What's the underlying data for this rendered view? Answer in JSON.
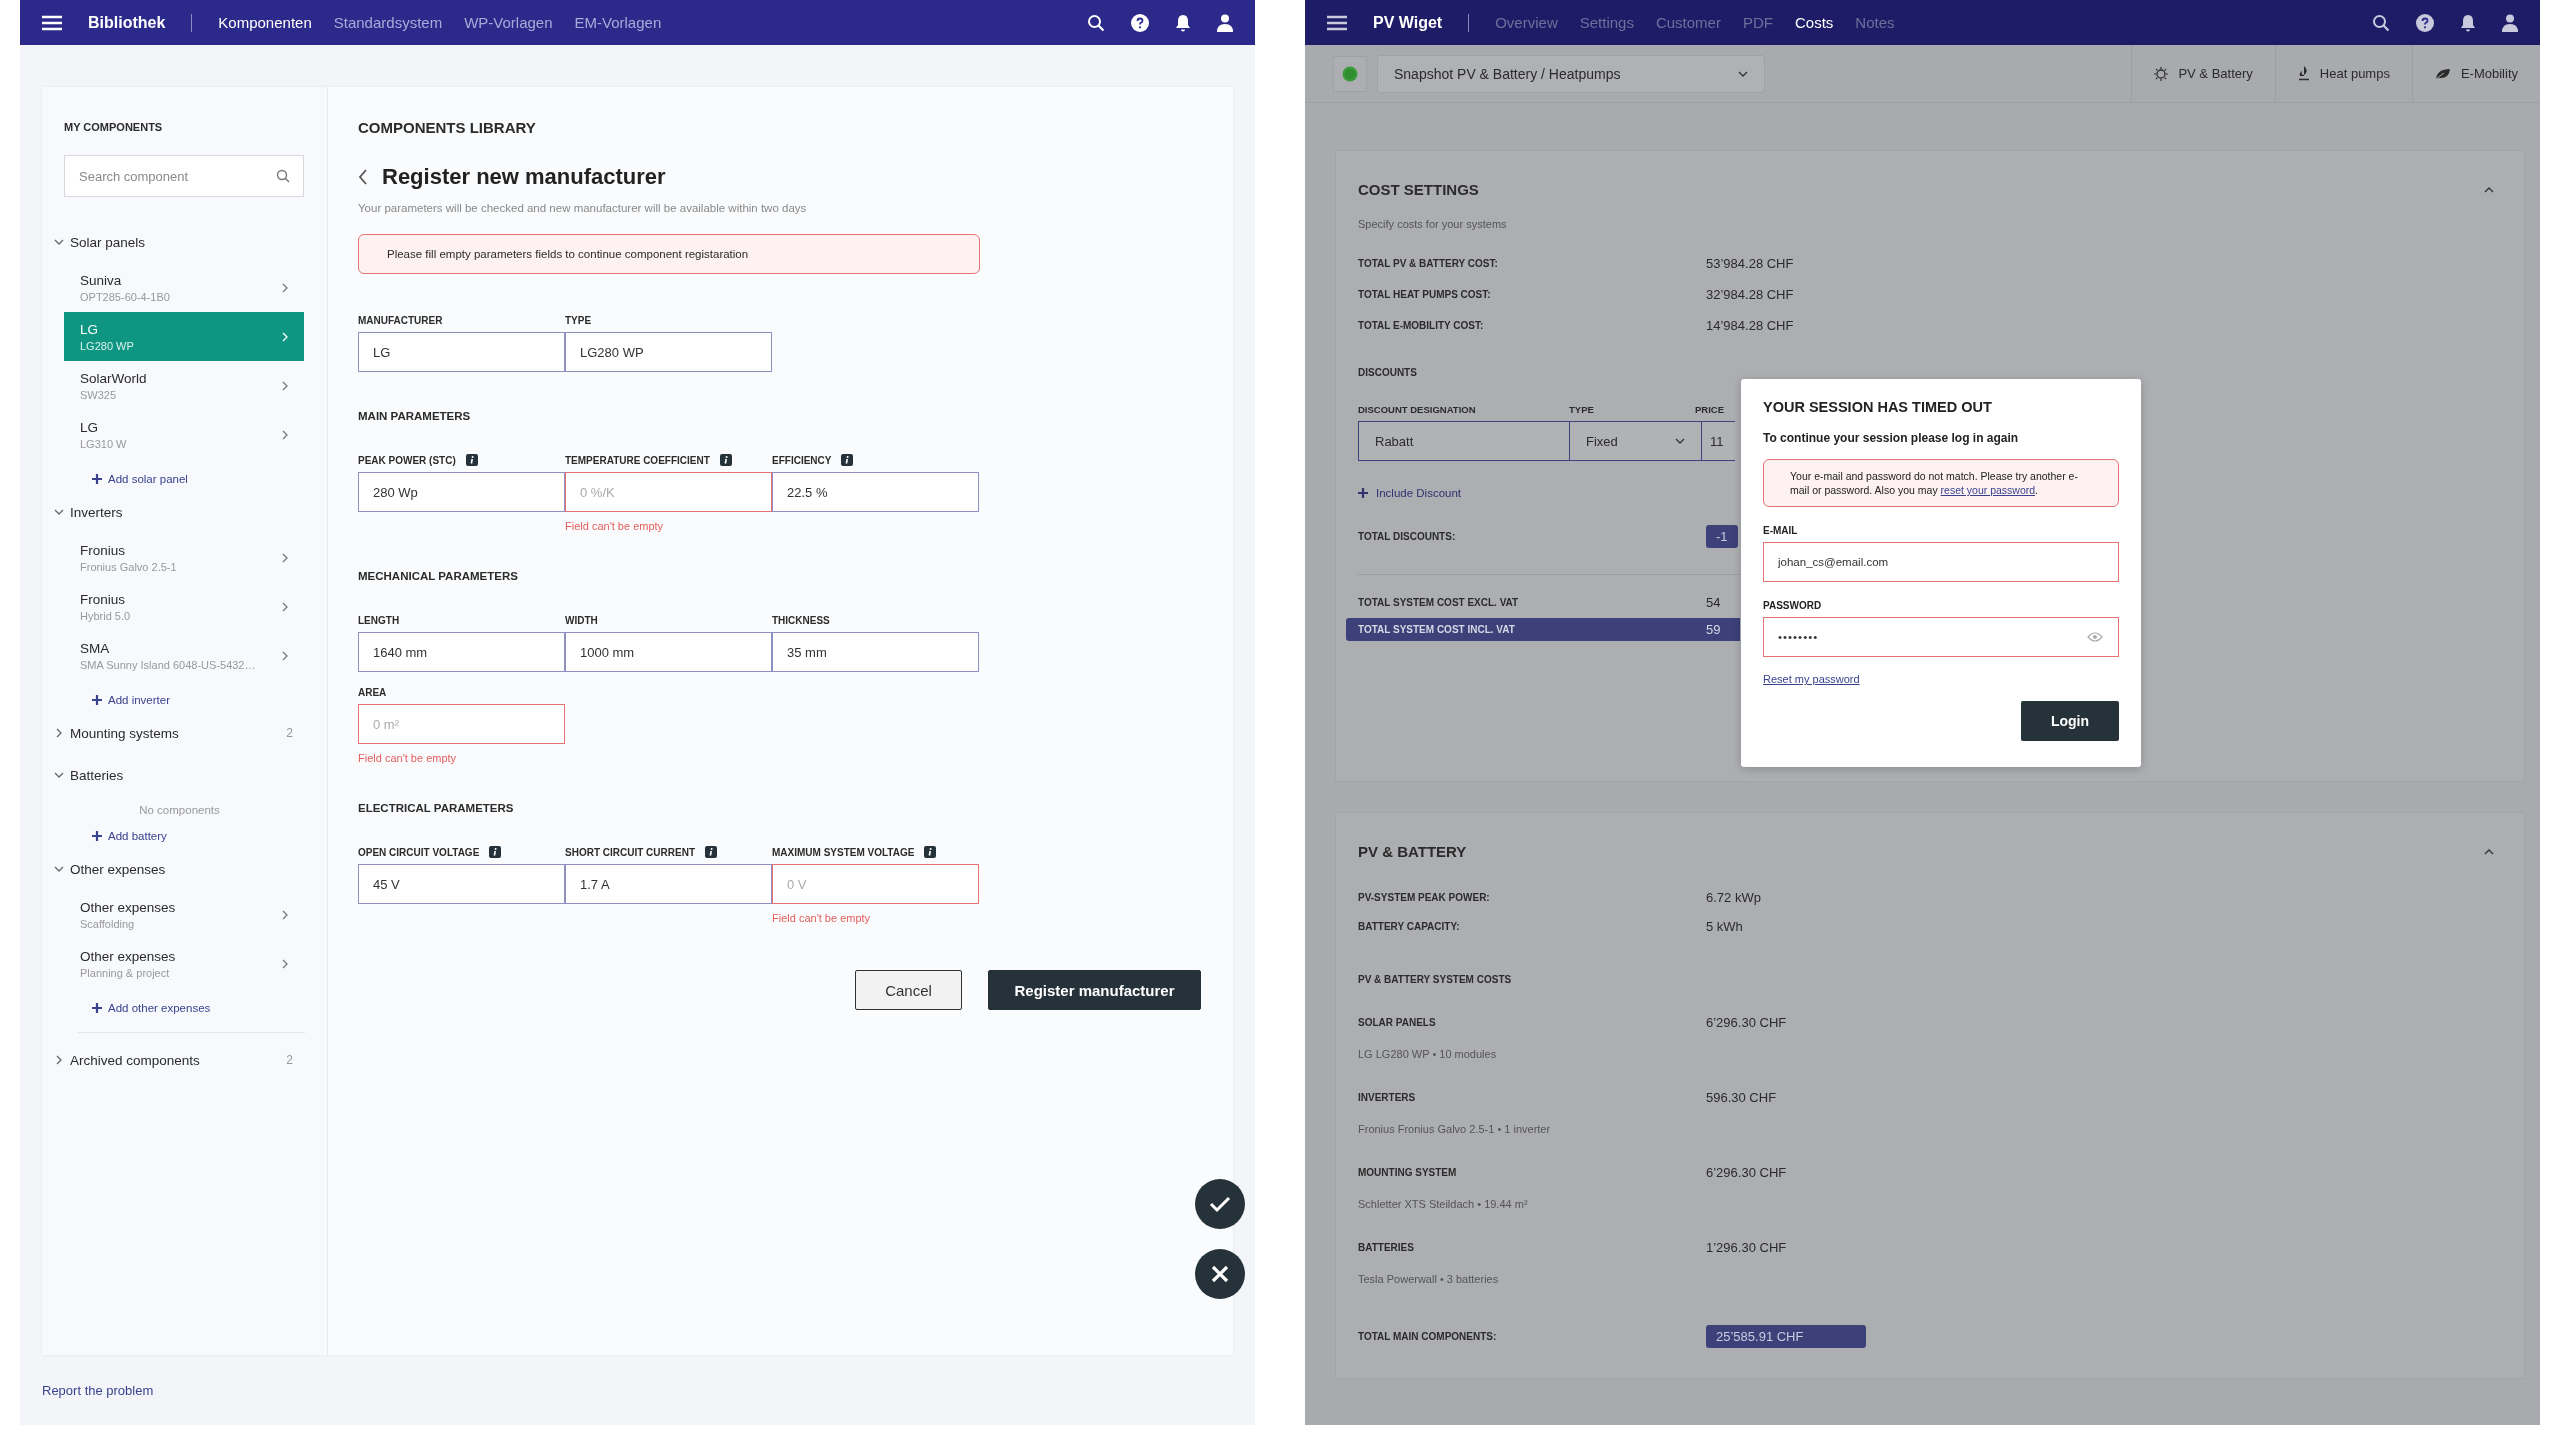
{
  "library_app": {
    "top_bar": {
      "title": "Bibliothek",
      "tabs": [
        {
          "label": "Komponenten",
          "selected": true
        },
        {
          "label": "Standardsystem",
          "selected": false
        },
        {
          "label": "WP-Vorlagen",
          "selected": false
        },
        {
          "label": "EM-Vorlagen",
          "selected": false
        }
      ]
    },
    "sidebar": {
      "heading": "MY COMPONENTS",
      "search": {
        "placeholder": "Search component"
      },
      "groups": [
        {
          "label": "Solar panels",
          "expanded": true,
          "items": [
            {
              "name": "Suniva",
              "model": "OPT285-60-4-1B0",
              "selected": false
            },
            {
              "name": "LG",
              "model": "LG280 WP",
              "selected": true
            },
            {
              "name": "SolarWorld",
              "model": "SW325",
              "selected": false
            },
            {
              "name": "LG",
              "model": "LG310 W",
              "selected": false
            }
          ],
          "add_label": "Add solar panel"
        },
        {
          "label": "Inverters",
          "expanded": true,
          "items": [
            {
              "name": "Fronius",
              "model": "Fronius Galvo 2.5-1",
              "selected": false
            },
            {
              "name": "Fronius",
              "model": "Hybrid 5.0",
              "selected": false
            },
            {
              "name": "SMA",
              "model": "SMA Sunny Island 6048-US-5432…",
              "selected": false
            }
          ],
          "add_label": "Add inverter"
        },
        {
          "label": "Mounting systems",
          "expanded": false,
          "count": "2"
        },
        {
          "label": "Batteries",
          "expanded": true,
          "empty_text": "No components",
          "add_label": "Add battery"
        },
        {
          "label": "Other expenses",
          "expanded": true,
          "items": [
            {
              "name": "Other expenses",
              "model": "Scaffolding",
              "selected": false
            },
            {
              "name": "Other expenses",
              "model": "Planning & project",
              "selected": false
            }
          ],
          "add_label": "Add other expenses"
        }
      ],
      "archived": {
        "label": "Archived components",
        "expanded": false,
        "count": "2"
      }
    },
    "main": {
      "heading": "COMPONENTS LIBRARY",
      "title": "Register new manufacturer",
      "subtitle": "Your parameters will be checked and new manufacturer will be available within two days",
      "alert": "Please fill empty parameters fields to continue component registaration",
      "sections": [
        {
          "rows": [
            [
              {
                "label": "MANUFACTURER",
                "value": "LG",
                "info": false,
                "invalid": false
              },
              {
                "label": "TYPE",
                "value": "LG280 WP",
                "info": false,
                "invalid": false
              }
            ]
          ]
        },
        {
          "title": "MAIN PARAMETERS",
          "rows": [
            [
              {
                "label": "PEAK POWER (STC)",
                "value": "280 Wp",
                "info": true,
                "invalid": false
              },
              {
                "label": "TEMPERATURE COEFFICIENT",
                "placeholder": "0 %/K",
                "info": true,
                "invalid": true,
                "error": "Field can't be empty"
              },
              {
                "label": "EFFICIENCY",
                "value": "22.5 %",
                "info": true,
                "invalid": false
              }
            ]
          ]
        },
        {
          "title": "MECHANICAL PARAMETERS",
          "rows": [
            [
              {
                "label": "LENGTH",
                "value": "1640 mm",
                "info": false,
                "invalid": false
              },
              {
                "label": "WIDTH",
                "value": "1000 mm",
                "info": false,
                "invalid": false
              },
              {
                "label": "THICKNESS",
                "value": "35 mm",
                "info": false,
                "invalid": false
              }
            ],
            [
              {
                "label": "AREA",
                "placeholder": "0 m²",
                "info": false,
                "invalid": true,
                "error": "Field can't be empty"
              }
            ]
          ]
        },
        {
          "title": "ELECTRICAL PARAMETERS",
          "rows": [
            [
              {
                "label": "OPEN CIRCUIT VOLTAGE",
                "value": "45 V",
                "info": true,
                "invalid": false
              },
              {
                "label": "SHORT CIRCUIT CURRENT",
                "value": "1.7 A",
                "info": true,
                "invalid": false
              },
              {
                "label": "MAXIMUM SYSTEM VOLTAGE",
                "placeholder": "0 V",
                "info": true,
                "invalid": true,
                "error": "Field can't be empty"
              }
            ]
          ]
        }
      ],
      "buttons": [
        {
          "label": "Cancel",
          "kind": "secondary"
        },
        {
          "label": "Register manufacturer",
          "kind": "primary"
        }
      ]
    },
    "footer_link": "Report the problem"
  },
  "pv_app": {
    "top_bar": {
      "title": "PV Wiget",
      "tabs": [
        {
          "label": "Overview",
          "selected": false
        },
        {
          "label": "Settings",
          "selected": false
        },
        {
          "label": "Customer",
          "selected": false
        },
        {
          "label": "PDF",
          "selected": false
        },
        {
          "label": "Costs",
          "selected": true
        },
        {
          "label": "Notes",
          "selected": false
        }
      ]
    },
    "toolbar": {
      "snapshot": "Snapshot PV & Battery / Heatpumps",
      "modules": [
        {
          "label": "PV & Battery",
          "kind": "pv"
        },
        {
          "label": "Heat pumps",
          "kind": "heat"
        },
        {
          "label": "E-Mobility",
          "kind": "mobility"
        }
      ]
    },
    "cost_settings": {
      "title": "COST SETTINGS",
      "expanded": true,
      "subtitle": "Specify costs for your systems",
      "totals": [
        {
          "label": "TOTAL PV & BATTERY COST:",
          "value": "53’984.28 CHF"
        },
        {
          "label": "TOTAL HEAT PUMPS COST:",
          "value": "32’984.28 CHF"
        },
        {
          "label": "TOTAL E-MOBILITY COST:",
          "value": "14’984.28 CHF"
        }
      ],
      "discounts": {
        "title": "DISCOUNTS",
        "columns": [
          "DISCOUNT DESIGNATION",
          "TYPE",
          "PRICE"
        ],
        "row": {
          "designation": "Rabatt",
          "type": "Fixed",
          "price": "11"
        },
        "add_label": "Include Discount"
      },
      "total_discounts": {
        "label": "TOTAL DISCOUNTS:",
        "value": "-1"
      },
      "system_totals": [
        {
          "label": "TOTAL SYSTEM COST EXCL. VAT",
          "value": "54",
          "highlighted": false
        },
        {
          "label": "TOTAL SYSTEM COST INCL. VAT",
          "value": "59",
          "highlighted": true
        }
      ]
    },
    "pv_battery": {
      "title": "PV & BATTERY",
      "expanded": true,
      "stats": [
        {
          "label": "PV-SYSTEM PEAK POWER:",
          "value": "6.72 kWp"
        },
        {
          "label": "BATTERY CAPACITY:",
          "value": "5 kWh"
        }
      ],
      "costs_title": "PV & BATTERY SYSTEM COSTS",
      "items": [
        {
          "label": "SOLAR PANELS",
          "value": "6’296.30 CHF",
          "detail": "LG LG280 WP • 10 modules"
        },
        {
          "label": "INVERTERS",
          "value": "596.30 CHF",
          "detail": "Fronius Fronius Galvo 2.5-1 • 1 inverter"
        },
        {
          "label": "MOUNTING SYSTEM",
          "value": "6’296.30 CHF",
          "detail": "Schletter XTS Steildach • 19.44 m²"
        },
        {
          "label": "BATTERIES",
          "value": "1’296.30 CHF",
          "detail": "Tesla Powerwall • 3 batteries"
        }
      ],
      "total": {
        "label": "TOTAL MAIN COMPONENTS:",
        "value": "25’585.91 CHF"
      }
    },
    "session_dialog": {
      "title": "YOUR SESSION HAS TIMED OUT",
      "subtitle": "To continue your session please log in again",
      "error": "Your e-mail and password do not match. Please try another e-mail or password. Also you may ",
      "error_link": "reset your password",
      "error_end": ".",
      "email": {
        "label": "E-MAIL",
        "value": "johan_cs@email.com",
        "invalid": true
      },
      "password": {
        "label": "PASSWORD",
        "value": "••••••••",
        "invalid": true
      },
      "reset_link": "Reset my password",
      "login_button": "Login"
    }
  }
}
